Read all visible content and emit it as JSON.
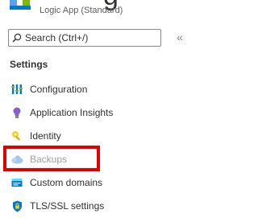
{
  "header": {
    "title_fragment": "g",
    "subtitle": "Logic App (Standard)"
  },
  "search": {
    "placeholder": "Search (Ctrl+/)",
    "collapse_glyph": "«"
  },
  "section": {
    "title": "Settings"
  },
  "nav_items": [
    {
      "label": "Configuration",
      "icon": "configuration-icon",
      "disabled": false
    },
    {
      "label": "Application Insights",
      "icon": "lightbulb-icon",
      "disabled": false
    },
    {
      "label": "Identity",
      "icon": "identity-key-icon",
      "disabled": false
    },
    {
      "label": "Backups",
      "icon": "cloud-backup-icon",
      "disabled": true
    },
    {
      "label": "Custom domains",
      "icon": "custom-domains-icon",
      "disabled": false
    },
    {
      "label": "TLS/SSL settings",
      "icon": "shield-icon",
      "disabled": false
    }
  ],
  "highlight": {
    "target": "Backups",
    "color": "#e00000"
  },
  "colors": {
    "accent_blue": "#0078d4",
    "text": "#323130",
    "disabled_text": "#a19f9d"
  }
}
